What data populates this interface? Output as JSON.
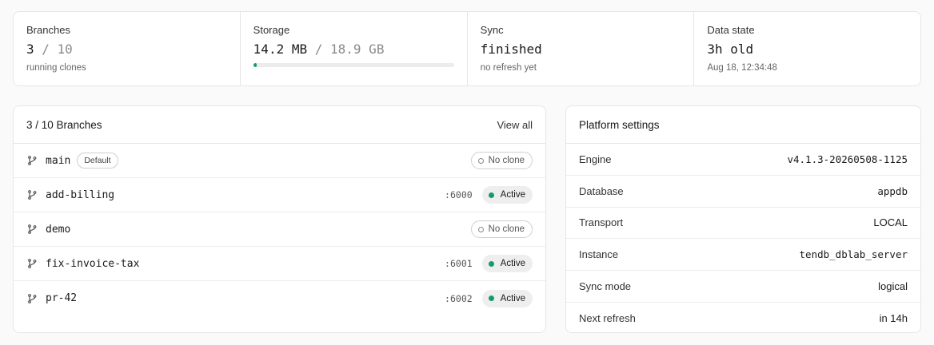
{
  "stats": {
    "branches": {
      "label": "Branches",
      "value": "3",
      "sep": "/ 10",
      "sub": "running clones"
    },
    "storage": {
      "label": "Storage",
      "value": "14.2 MB",
      "sep": "/ 18.9 GB",
      "usage_fraction": 0.0008
    },
    "sync": {
      "label": "Sync",
      "value": "finished",
      "sub": "no refresh yet"
    },
    "data_state": {
      "label": "Data state",
      "value": "3h old",
      "sub": "Aug 18, 12:34:48"
    }
  },
  "branches_card": {
    "title": "3 / 10 Branches",
    "view_all": "View all",
    "rows": [
      {
        "name": "main",
        "tag": "Default",
        "port": "",
        "status": "No clone"
      },
      {
        "name": "add-billing",
        "tag": "",
        "port": ":6000",
        "status": "Active"
      },
      {
        "name": "demo",
        "tag": "",
        "port": "",
        "status": "No clone"
      },
      {
        "name": "fix-invoice-tax",
        "tag": "",
        "port": ":6001",
        "status": "Active"
      },
      {
        "name": "pr-42",
        "tag": "",
        "port": ":6002",
        "status": "Active"
      }
    ]
  },
  "settings_card": {
    "title": "Platform settings",
    "rows": [
      {
        "label": "Engine",
        "value": "v4.1.3-20260508-1125",
        "mono": true
      },
      {
        "label": "Database",
        "value": "appdb",
        "mono": true
      },
      {
        "label": "Transport",
        "value": "LOCAL",
        "mono": false
      },
      {
        "label": "Instance",
        "value": "tendb_dblab_server",
        "mono": true
      },
      {
        "label": "Sync mode",
        "value": "logical",
        "mono": false
      },
      {
        "label": "Next refresh",
        "value": "in 14h",
        "mono": false
      }
    ]
  },
  "icons": {
    "branch": "git-branch-icon",
    "status_dot": "status-dot-icon"
  },
  "colors": {
    "active": "#119c6b",
    "border": "#e6e6e6"
  }
}
